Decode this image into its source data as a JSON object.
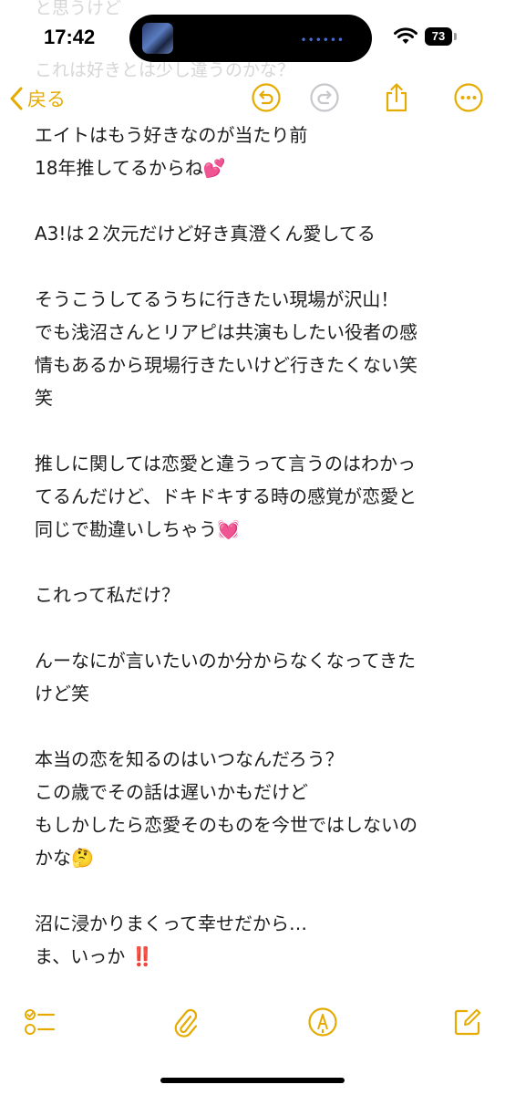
{
  "status_bar": {
    "time": "17:42",
    "battery": "73"
  },
  "background_text": [
    "と思うけど",
    "これは好きとは少し違うのかな？"
  ],
  "nav": {
    "back_label": "戻る"
  },
  "note": {
    "paragraphs": [
      [
        "エイトはもう好きなのが当たり前",
        "18年推してるからね💕"
      ],
      [
        "A3!は２次元だけど好き真澄くん愛してる"
      ],
      [
        "そうこうしてるうちに行きたい現場が沢山！",
        "でも浅沼さんとリアピは共演もしたい役者の感",
        "情もあるから現場行きたいけど行きたくない笑",
        "笑"
      ],
      [
        "推しに関しては恋愛と違うって言うのはわかっ",
        "てるんだけど、ドキドキする時の感覚が恋愛と",
        "同じで勘違いしちゃう💓"
      ],
      [
        "これって私だけ？"
      ],
      [
        "んーなにが言いたいのか分からなくなってきた",
        "けど笑"
      ],
      [
        "本当の恋を知るのはいつなんだろう？",
        "この歳でその話は遅いかもだけど",
        "もしかしたら恋愛そのものを今世ではしないの",
        "かな🤔"
      ],
      [
        "沼に浸かりまくって幸せだから…",
        "ま、いっか ‼️"
      ]
    ]
  },
  "colors": {
    "accent": "#e5ab00",
    "text": "#1c1c1e"
  },
  "icons": {
    "undo": "undo-arrow-icon",
    "redo": "redo-arrow-icon",
    "share": "share-icon",
    "more": "more-ellipsis-icon",
    "checklist": "checklist-icon",
    "attachment": "paperclip-icon",
    "markup": "markup-pen-icon",
    "compose": "compose-icon"
  }
}
